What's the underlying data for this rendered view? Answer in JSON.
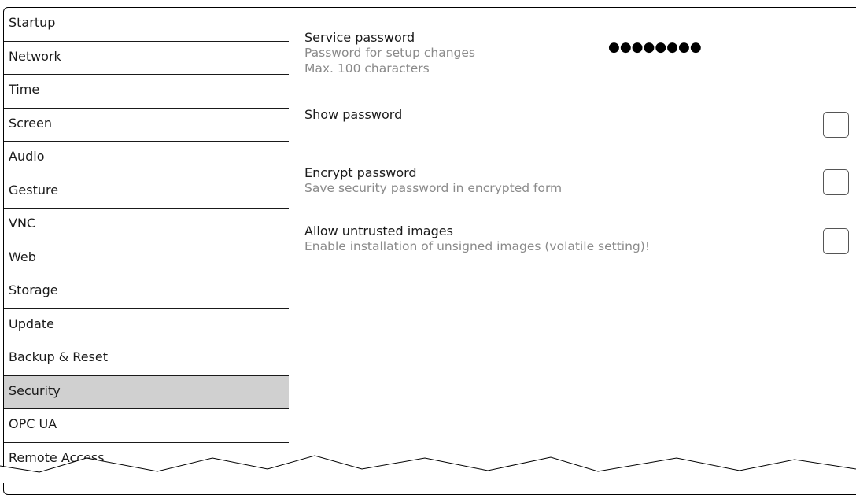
{
  "sidebar": {
    "items": [
      {
        "label": "Startup"
      },
      {
        "label": "Network"
      },
      {
        "label": "Time"
      },
      {
        "label": "Screen"
      },
      {
        "label": "Audio"
      },
      {
        "label": "Gesture"
      },
      {
        "label": "VNC"
      },
      {
        "label": "Web"
      },
      {
        "label": "Storage"
      },
      {
        "label": "Update"
      },
      {
        "label": "Backup & Reset"
      },
      {
        "label": "Security"
      },
      {
        "label": "OPC UA"
      },
      {
        "label": "Remote Access"
      }
    ],
    "active": "Security"
  },
  "settings": {
    "service_password": {
      "title": "Service password",
      "desc1": "Password for setup changes",
      "desc2": "Max. 100 characters",
      "value": "●●●●●●●●"
    },
    "show_password": {
      "title": "Show password",
      "checked": false
    },
    "encrypt_password": {
      "title": "Encrypt password",
      "desc": "Save security password in encrypted form",
      "checked": false
    },
    "allow_untrusted": {
      "title": "Allow untrusted images",
      "desc": "Enable installation of unsigned images (volatile setting)!",
      "checked": false
    }
  },
  "colors": {
    "active_item_bg": "#d0d0d0",
    "desc_text": "#8a8a8a"
  }
}
